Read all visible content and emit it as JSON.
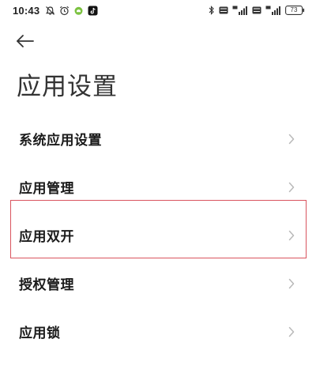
{
  "status_bar": {
    "time": "10:43",
    "battery": "73",
    "left_icons": [
      "alarm-muted-icon",
      "alarm-clock-icon",
      "android-notification-icon",
      "tiktok-icon"
    ],
    "right_icons": [
      "bluetooth-icon",
      "hd-icon",
      "signal-4g-icon",
      "hd-icon",
      "signal-4g-icon",
      "battery-icon"
    ]
  },
  "header": {
    "back_icon": "arrow-left-icon",
    "title": "应用设置"
  },
  "settings": {
    "items": [
      {
        "label": "系统应用设置"
      },
      {
        "label": "应用管理"
      },
      {
        "label": "应用双开"
      },
      {
        "label": "授权管理"
      },
      {
        "label": "应用锁"
      }
    ],
    "chevron_icon": "chevron-right-icon"
  },
  "colors": {
    "text": "#1a1a1a",
    "chevron": "#b9b9b9",
    "highlight": "#d9545e",
    "background": "#ffffff"
  }
}
